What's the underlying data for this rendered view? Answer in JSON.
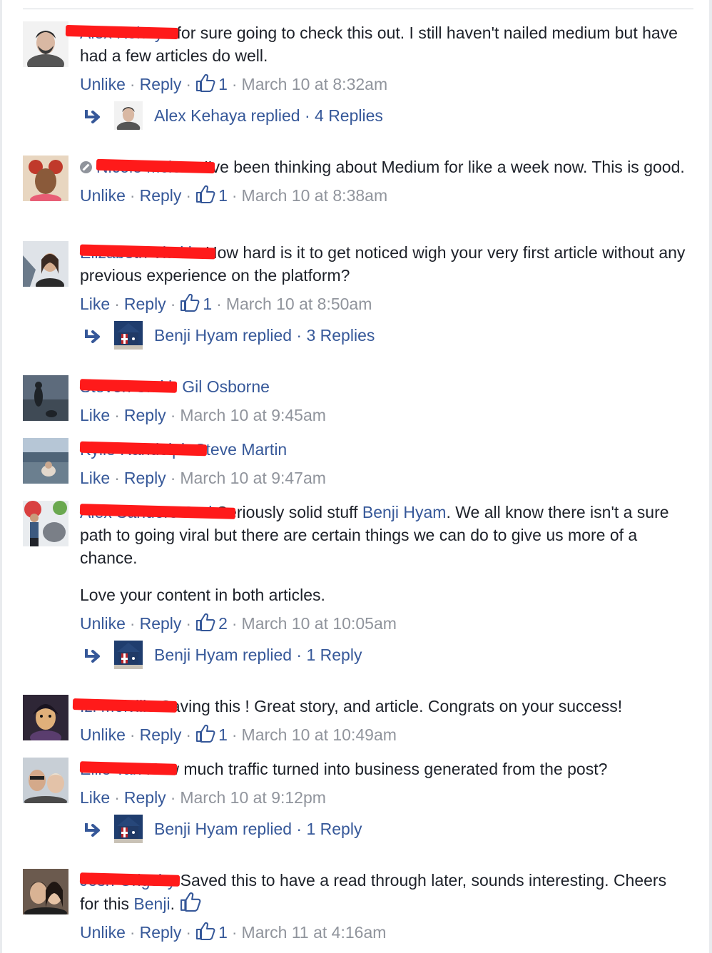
{
  "colors": {
    "link": "#365899",
    "meta": "#90949c",
    "text": "#1d2129",
    "redaction": "#ff1a1a"
  },
  "icons": {
    "like": "thumbs-up-icon",
    "reply_arrow": "reply-arrow-icon",
    "blocked": "blocked-user-icon"
  },
  "comments": [
    {
      "author": "Alex Kehaya",
      "text": "for sure going to check this out. I still haven't nailed medium but have had a few articles do well.",
      "action_like": "Unlike",
      "action_reply": "Reply",
      "likes": "1",
      "time": "March 10 at 8:32am",
      "reply_summary": "Alex Kehaya replied · 4 Replies"
    },
    {
      "author": "Nicole Mclean",
      "text": "I've been thinking about Medium for like a week now. This is good.",
      "action_like": "Unlike",
      "action_reply": "Reply",
      "likes": "1",
      "time": "March 10 at 8:38am"
    },
    {
      "author": "Elizabeth Viatkin",
      "text": "How hard is it to get noticed wigh your very first article without any previous experience on the platform?",
      "action_like": "Like",
      "action_reply": "Reply",
      "likes": "1",
      "time": "March 10 at 8:50am",
      "reply_summary": "Benji Hyam replied · 3 Replies"
    },
    {
      "author": "Steven Smith",
      "mention": "Gil Osborne",
      "action_like": "Like",
      "action_reply": "Reply",
      "time": "March 10 at 9:45am"
    },
    {
      "author": "Kylie Randolph",
      "mention": "Steve Martin",
      "action_like": "Like",
      "action_reply": "Reply",
      "time": "March 10 at 9:47am"
    },
    {
      "author": "Alex Sanders Carl",
      "text_before": "Seriously solid stuff",
      "mention": "Benji Hyam",
      "text_after": ". We all know there isn't a sure path to going viral but there are certain things we can do to give us more of a chance.",
      "text_second": "Love your content in both articles.",
      "action_like": "Unlike",
      "action_reply": "Reply",
      "likes": "2",
      "time": "March 10 at 10:05am",
      "reply_summary": "Benji Hyam replied · 1 Reply"
    },
    {
      "author": "Izi Melville",
      "text": "Saving this ! Great story, and article. Congrats on your success!",
      "action_like": "Unlike",
      "action_reply": "Reply",
      "likes": "1",
      "time": "March 10 at 10:49am"
    },
    {
      "author": "Ellie Tan",
      "text": "How much traffic turned into business generated from the post?",
      "action_like": "Like",
      "action_reply": "Reply",
      "time": "March 10 at 9:12pm",
      "reply_summary": "Benji Hyam replied · 1 Reply"
    },
    {
      "author": "Josh Grigsby",
      "text_before": "Saved this to have a read through later, sounds interesting. Cheers for this",
      "mention": "Benji",
      "text_after": ".",
      "action_like": "Unlike",
      "action_reply": "Reply",
      "likes": "1",
      "time": "March 11 at 4:16am"
    }
  ]
}
